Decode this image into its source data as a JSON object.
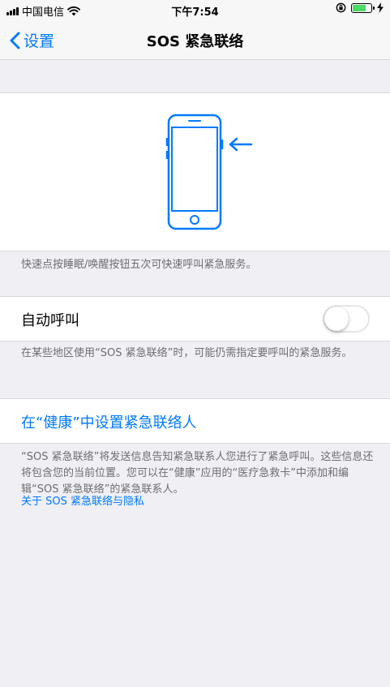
{
  "status_bar": {
    "carrier": "中国电信",
    "time": "下午7:54",
    "battery_color": "#4cd964"
  },
  "nav": {
    "back_label": "设置",
    "title": "SOS 紧急联络"
  },
  "illustration": {
    "caption": "快速点按睡眠/唤醒按钮五次可快速呼叫紧急服务。",
    "icon": "iphone-side-button-icon",
    "accent": "#007aff"
  },
  "auto_call": {
    "label": "自动呼叫",
    "enabled": false,
    "footer": "在某些地区使用“SOS 紧急联络”时，可能仍需指定要呼叫的紧急服务。"
  },
  "health": {
    "link_label": "在“健康”中设置紧急联络人",
    "footer": "“SOS 紧急联络”将发送信息告知紧急联系人您进行了紧急呼叫。这些信息还将包含您的当前位置。您可以在“健康”应用的“医疗急救卡”中添加和编辑“SOS 紧急联络”的紧急联系人。",
    "privacy_link": "关于 SOS 紧急联络与隐私"
  }
}
